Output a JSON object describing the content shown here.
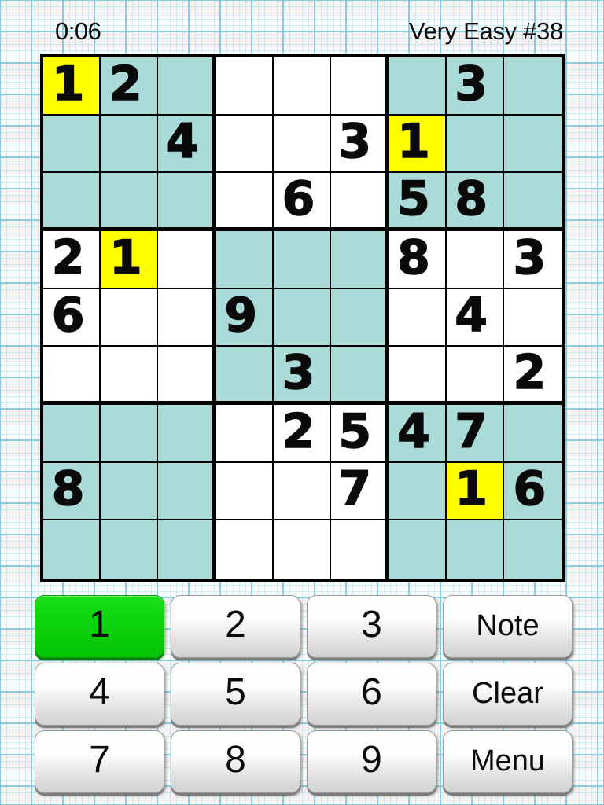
{
  "header": {
    "timer": "0:06",
    "puzzle_label": "Very Easy #38"
  },
  "colors": {
    "shaded_cell": "#abdbd8",
    "highlight_cell": "#ffff00",
    "selected_button": "#00cc00",
    "grid_line": "#000000",
    "paper_grid_line": "#78c8e1"
  },
  "board": {
    "rows": 9,
    "columns": 9,
    "cells": [
      [
        {
          "value": "1",
          "state": "highlight"
        },
        {
          "value": "2",
          "state": "shaded"
        },
        {
          "value": "",
          "state": "shaded"
        },
        {
          "value": "",
          "state": "plain"
        },
        {
          "value": "",
          "state": "plain"
        },
        {
          "value": "",
          "state": "plain"
        },
        {
          "value": "",
          "state": "shaded"
        },
        {
          "value": "3",
          "state": "shaded"
        },
        {
          "value": "",
          "state": "shaded"
        }
      ],
      [
        {
          "value": "",
          "state": "shaded"
        },
        {
          "value": "",
          "state": "shaded"
        },
        {
          "value": "4",
          "state": "shaded"
        },
        {
          "value": "",
          "state": "plain"
        },
        {
          "value": "",
          "state": "plain"
        },
        {
          "value": "3",
          "state": "plain"
        },
        {
          "value": "1",
          "state": "highlight"
        },
        {
          "value": "",
          "state": "shaded"
        },
        {
          "value": "",
          "state": "shaded"
        }
      ],
      [
        {
          "value": "",
          "state": "shaded"
        },
        {
          "value": "",
          "state": "shaded"
        },
        {
          "value": "",
          "state": "shaded"
        },
        {
          "value": "",
          "state": "plain"
        },
        {
          "value": "6",
          "state": "plain"
        },
        {
          "value": "",
          "state": "plain"
        },
        {
          "value": "5",
          "state": "shaded"
        },
        {
          "value": "8",
          "state": "shaded"
        },
        {
          "value": "",
          "state": "shaded"
        }
      ],
      [
        {
          "value": "2",
          "state": "plain"
        },
        {
          "value": "1",
          "state": "highlight"
        },
        {
          "value": "",
          "state": "plain"
        },
        {
          "value": "",
          "state": "shaded"
        },
        {
          "value": "",
          "state": "shaded"
        },
        {
          "value": "",
          "state": "shaded"
        },
        {
          "value": "8",
          "state": "plain"
        },
        {
          "value": "",
          "state": "plain"
        },
        {
          "value": "3",
          "state": "plain"
        }
      ],
      [
        {
          "value": "6",
          "state": "plain"
        },
        {
          "value": "",
          "state": "plain"
        },
        {
          "value": "",
          "state": "plain"
        },
        {
          "value": "9",
          "state": "shaded"
        },
        {
          "value": "",
          "state": "shaded"
        },
        {
          "value": "",
          "state": "shaded"
        },
        {
          "value": "",
          "state": "plain"
        },
        {
          "value": "4",
          "state": "plain"
        },
        {
          "value": "",
          "state": "plain"
        }
      ],
      [
        {
          "value": "",
          "state": "plain"
        },
        {
          "value": "",
          "state": "plain"
        },
        {
          "value": "",
          "state": "plain"
        },
        {
          "value": "",
          "state": "shaded"
        },
        {
          "value": "3",
          "state": "shaded"
        },
        {
          "value": "",
          "state": "shaded"
        },
        {
          "value": "",
          "state": "plain"
        },
        {
          "value": "",
          "state": "plain"
        },
        {
          "value": "2",
          "state": "plain"
        }
      ],
      [
        {
          "value": "",
          "state": "shaded"
        },
        {
          "value": "",
          "state": "shaded"
        },
        {
          "value": "",
          "state": "shaded"
        },
        {
          "value": "",
          "state": "plain"
        },
        {
          "value": "2",
          "state": "plain"
        },
        {
          "value": "5",
          "state": "plain"
        },
        {
          "value": "4",
          "state": "shaded"
        },
        {
          "value": "7",
          "state": "shaded"
        },
        {
          "value": "",
          "state": "shaded"
        }
      ],
      [
        {
          "value": "8",
          "state": "shaded"
        },
        {
          "value": "",
          "state": "shaded"
        },
        {
          "value": "",
          "state": "shaded"
        },
        {
          "value": "",
          "state": "plain"
        },
        {
          "value": "",
          "state": "plain"
        },
        {
          "value": "7",
          "state": "plain"
        },
        {
          "value": "",
          "state": "shaded"
        },
        {
          "value": "1",
          "state": "highlight"
        },
        {
          "value": "6",
          "state": "shaded"
        }
      ],
      [
        {
          "value": "",
          "state": "shaded"
        },
        {
          "value": "",
          "state": "shaded"
        },
        {
          "value": "",
          "state": "shaded"
        },
        {
          "value": "",
          "state": "plain"
        },
        {
          "value": "",
          "state": "plain"
        },
        {
          "value": "",
          "state": "plain"
        },
        {
          "value": "",
          "state": "shaded"
        },
        {
          "value": "",
          "state": "shaded"
        },
        {
          "value": "",
          "state": "shaded"
        }
      ]
    ]
  },
  "keypad": {
    "selected": "1",
    "buttons": [
      {
        "label": "1",
        "kind": "digit",
        "selected": true
      },
      {
        "label": "2",
        "kind": "digit",
        "selected": false
      },
      {
        "label": "3",
        "kind": "digit",
        "selected": false
      },
      {
        "label": "Note",
        "kind": "word",
        "selected": false
      },
      {
        "label": "4",
        "kind": "digit",
        "selected": false
      },
      {
        "label": "5",
        "kind": "digit",
        "selected": false
      },
      {
        "label": "6",
        "kind": "digit",
        "selected": false
      },
      {
        "label": "Clear",
        "kind": "word",
        "selected": false
      },
      {
        "label": "7",
        "kind": "digit",
        "selected": false
      },
      {
        "label": "8",
        "kind": "digit",
        "selected": false
      },
      {
        "label": "9",
        "kind": "digit",
        "selected": false
      },
      {
        "label": "Menu",
        "kind": "word",
        "selected": false
      }
    ]
  }
}
